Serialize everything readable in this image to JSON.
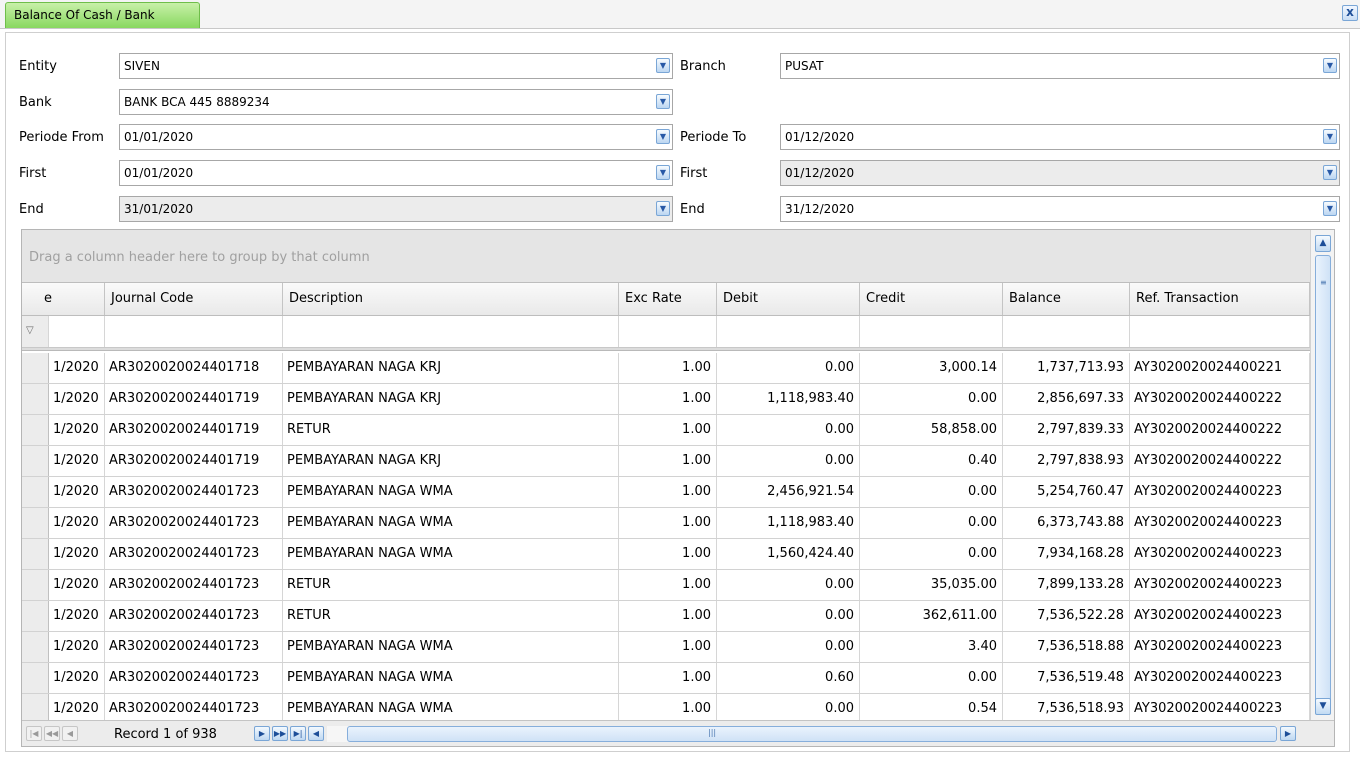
{
  "tab": {
    "title": "Balance Of Cash / Bank"
  },
  "window": {
    "close_glyph": "x"
  },
  "form": {
    "entity": {
      "label": "Entity",
      "value": "SIVEN"
    },
    "branch": {
      "label": "Branch",
      "value": "PUSAT"
    },
    "bank": {
      "label": "Bank",
      "value": "BANK BCA 445 8889234"
    },
    "periode_from": {
      "label": "Periode From",
      "value": "01/01/2020"
    },
    "periode_to": {
      "label": "Periode To",
      "value": "01/12/2020"
    },
    "first_from": {
      "label": "First",
      "value": "01/01/2020"
    },
    "first_to": {
      "label": "First",
      "value": "01/12/2020"
    },
    "end_from": {
      "label": "End",
      "value": "31/01/2020"
    },
    "end_to": {
      "label": "End",
      "value": "31/12/2020"
    }
  },
  "grid": {
    "group_hint": "Drag a column header here to group by that column",
    "columns": [
      "e",
      "Journal Code",
      "Description",
      "Exc Rate",
      "Debit",
      "Credit",
      "Balance",
      "Ref. Transaction"
    ],
    "rows": [
      [
        "1/2020",
        "AR3020020024401718",
        "PEMBAYARAN NAGA KRJ",
        "1.00",
        "0.00",
        "3,000.14",
        "1,737,713.93",
        "AY3020020024400221"
      ],
      [
        "1/2020",
        "AR3020020024401719",
        "PEMBAYARAN NAGA KRJ",
        "1.00",
        "1,118,983.40",
        "0.00",
        "2,856,697.33",
        "AY3020020024400222"
      ],
      [
        "1/2020",
        "AR3020020024401719",
        "RETUR",
        "1.00",
        "0.00",
        "58,858.00",
        "2,797,839.33",
        "AY3020020024400222"
      ],
      [
        "1/2020",
        "AR3020020024401719",
        "PEMBAYARAN NAGA KRJ",
        "1.00",
        "0.00",
        "0.40",
        "2,797,838.93",
        "AY3020020024400222"
      ],
      [
        "1/2020",
        "AR3020020024401723",
        "PEMBAYARAN NAGA WMA",
        "1.00",
        "2,456,921.54",
        "0.00",
        "5,254,760.47",
        "AY3020020024400223"
      ],
      [
        "1/2020",
        "AR3020020024401723",
        "PEMBAYARAN NAGA WMA",
        "1.00",
        "1,118,983.40",
        "0.00",
        "6,373,743.88",
        "AY3020020024400223"
      ],
      [
        "1/2020",
        "AR3020020024401723",
        "PEMBAYARAN NAGA WMA",
        "1.00",
        "1,560,424.40",
        "0.00",
        "7,934,168.28",
        "AY3020020024400223"
      ],
      [
        "1/2020",
        "AR3020020024401723",
        "RETUR",
        "1.00",
        "0.00",
        "35,035.00",
        "7,899,133.28",
        "AY3020020024400223"
      ],
      [
        "1/2020",
        "AR3020020024401723",
        "RETUR",
        "1.00",
        "0.00",
        "362,611.00",
        "7,536,522.28",
        "AY3020020024400223"
      ],
      [
        "1/2020",
        "AR3020020024401723",
        "PEMBAYARAN NAGA WMA",
        "1.00",
        "0.00",
        "3.40",
        "7,536,518.88",
        "AY3020020024400223"
      ],
      [
        "1/2020",
        "AR3020020024401723",
        "PEMBAYARAN NAGA WMA",
        "1.00",
        "0.60",
        "0.00",
        "7,536,519.48",
        "AY3020020024400223"
      ],
      [
        "1/2020",
        "AR3020020024401723",
        "PEMBAYARAN NAGA WMA",
        "1.00",
        "0.00",
        "0.54",
        "7,536,518.93",
        "AY3020020024400223"
      ]
    ],
    "record_text": "Record 1 of 938"
  },
  "icons": {
    "dropdown": "chevron-down-icon",
    "filter": "filter-funnel-icon",
    "close": "close-icon",
    "nav_first": "first-record-icon",
    "nav_prev_page": "prev-page-icon",
    "nav_prev": "prev-record-icon",
    "nav_next": "next-record-icon",
    "nav_next_page": "next-page-icon",
    "nav_last": "last-record-icon"
  },
  "colors": {
    "tab_green": "#88d860",
    "accent_blue": "#7aa6d6",
    "group_panel": "#e5e5e5"
  }
}
